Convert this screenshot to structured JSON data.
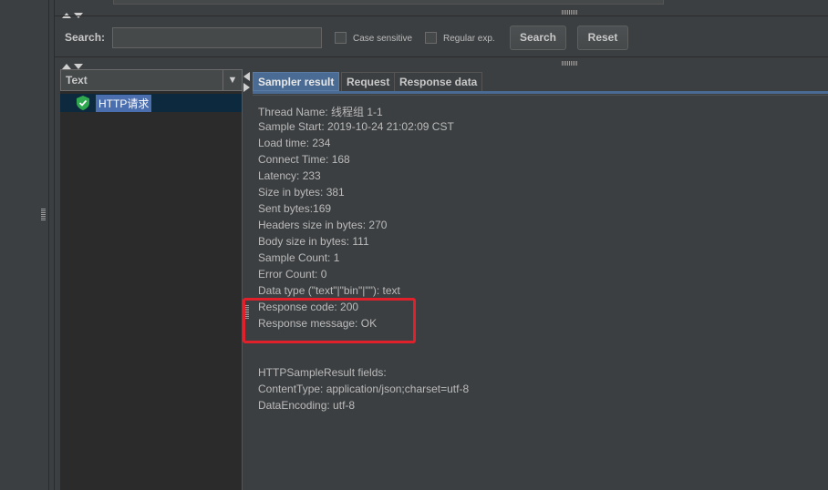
{
  "search": {
    "label": "Search:",
    "value": "",
    "placeholder": "",
    "case_sensitive_label": "Case sensitive",
    "regular_exp_label": "Regular exp.",
    "search_button": "Search",
    "reset_button": "Reset"
  },
  "tree": {
    "header_label": "Text",
    "dropdown_glyph": "▼",
    "items": [
      {
        "label": "HTTP请求",
        "status": "success"
      }
    ]
  },
  "tabs": [
    {
      "label": "Sampler result",
      "active": true
    },
    {
      "label": "Request",
      "active": false
    },
    {
      "label": "Response data",
      "active": false
    }
  ],
  "sampler_result": {
    "lines": [
      "Thread Name: 线程组 1-1",
      "Sample Start: 2019-10-24 21:02:09 CST",
      "Load time: 234",
      "Connect Time: 168",
      "Latency: 233",
      "Size in bytes: 381",
      "Sent bytes:169",
      "Headers size in bytes: 270",
      "Body size in bytes: 111",
      "Sample Count: 1",
      "Error Count: 0",
      "Data type (\"text\"|\"bin\"|\"\"): text",
      "Response code: 200",
      "Response message: OK",
      "",
      "",
      "HTTPSampleResult fields:",
      "ContentType: application/json;charset=utf-8",
      "DataEncoding: utf-8"
    ]
  },
  "colors": {
    "highlight": "#e0202a",
    "active_tab": "#4a6b93",
    "selection": "#4b6eaf",
    "success_icon": "#2fa84f"
  }
}
